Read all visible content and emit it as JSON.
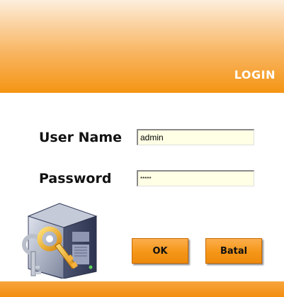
{
  "header": {
    "title": "LOGIN"
  },
  "form": {
    "username": {
      "label": "User Name",
      "value": "admin"
    },
    "password": {
      "label": "Password",
      "value": "*****"
    }
  },
  "buttons": {
    "ok_label": "OK",
    "cancel_label": "Batal"
  },
  "colors": {
    "accent": "#f49514",
    "input_bg": "#ffffe5"
  },
  "icons": {
    "illustration": "server-key-icon"
  }
}
